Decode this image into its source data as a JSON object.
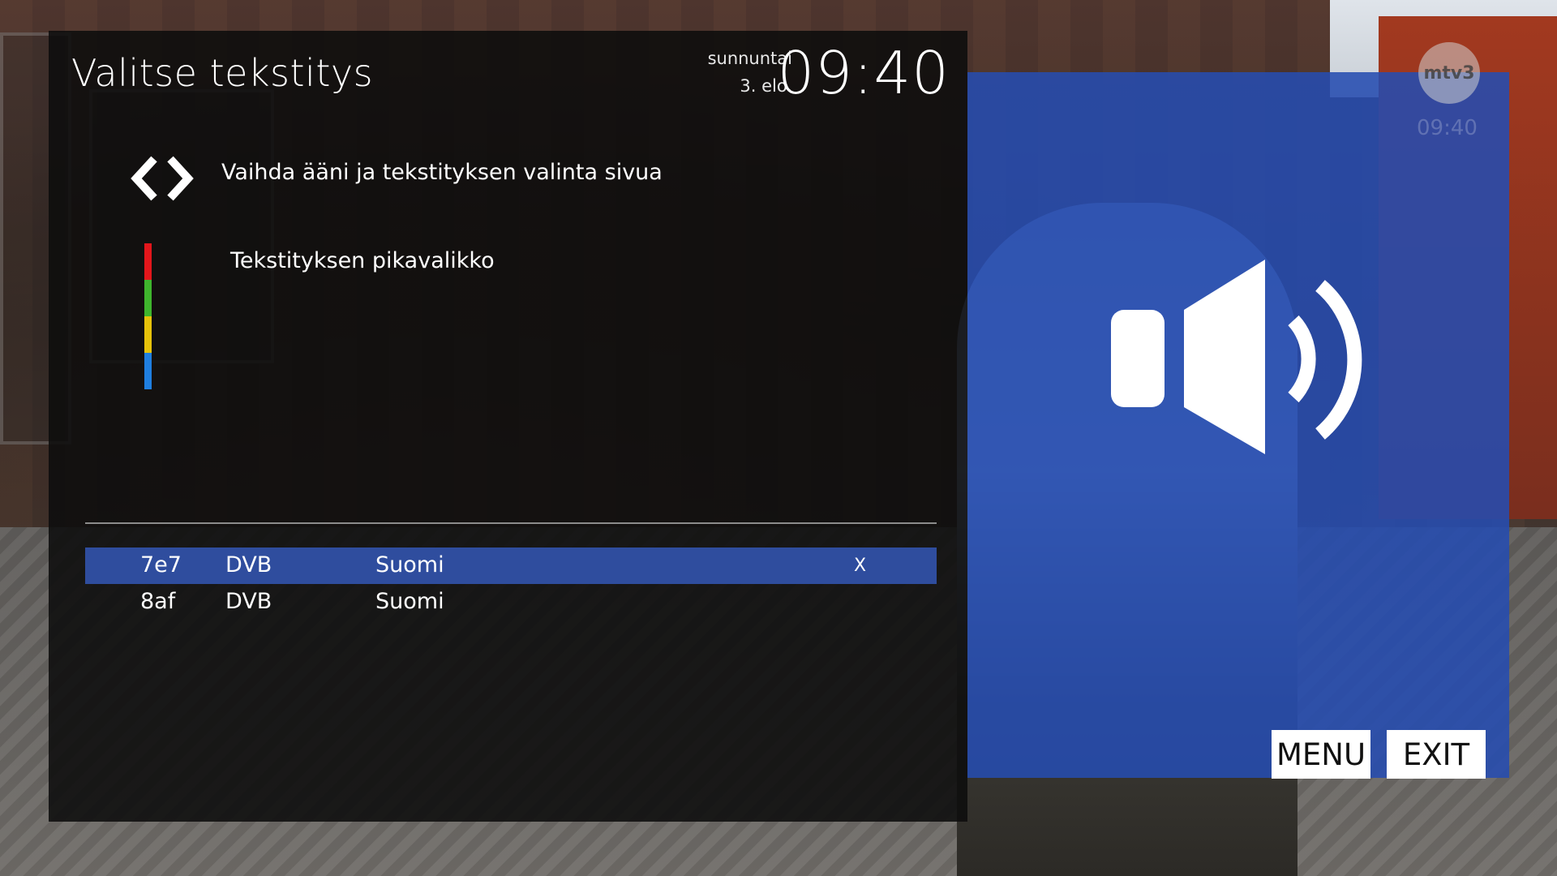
{
  "title": "Valitse tekstitys",
  "datetime": {
    "weekday": "sunnuntai",
    "date": "3. elo.",
    "time": "09:40"
  },
  "hints": {
    "nav": "Vaihda ääni ja tekstityksen valinta sivua",
    "quick_menu": "Tekstityksen pikavalikko"
  },
  "color_keys": [
    "#e3161b",
    "#3fb52d",
    "#e6c20a",
    "#1f7fe0"
  ],
  "subtitles": [
    {
      "id": "7e7",
      "type": "DVB",
      "language": "Suomi",
      "marker": "X",
      "selected": true
    },
    {
      "id": "8af",
      "type": "DVB",
      "language": "Suomi",
      "marker": "",
      "selected": false
    }
  ],
  "side_panel": {
    "icon": "speaker-icon",
    "accent_color": "#2f4d9e"
  },
  "channel": {
    "logo_text": "mtv3",
    "time": "09:40"
  },
  "buttons": {
    "menu": "MENU",
    "exit": "EXIT"
  }
}
